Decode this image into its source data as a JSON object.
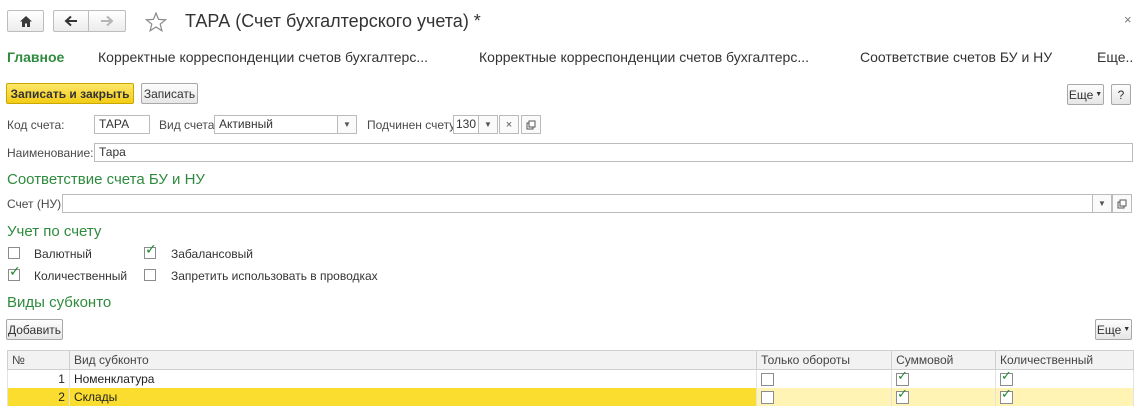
{
  "window": {
    "title": "ТАРА (Счет бухгалтерского учета) *",
    "close_glyph": "×"
  },
  "tabs": [
    {
      "label": "Главное",
      "active": true
    },
    {
      "label": "Корректные корреспонденции счетов бухгалтерс..."
    },
    {
      "label": "Корректные корреспонденции счетов бухгалтерс..."
    },
    {
      "label": "Соответствие счетов БУ и НУ"
    },
    {
      "label": "Еще..."
    }
  ],
  "toolbar": {
    "save_close_label": "Записать и закрыть",
    "save_label": "Записать",
    "more_label": "Еще",
    "help_label": "?"
  },
  "fields": {
    "code_label": "Код счета:",
    "code_value": "ТАРА",
    "type_label": "Вид счета:",
    "type_value": "Активный",
    "parent_label": "Подчинен счету:",
    "parent_value": "130",
    "name_label": "Наименование:",
    "name_value": "Тара"
  },
  "sections": {
    "mapping_title": "Соответствие счета БУ и НУ",
    "tax_account_label": "Счет (НУ):",
    "tax_account_value": "",
    "accounting_title": "Учет по счету",
    "subconto_title": "Виды субконто"
  },
  "checkboxes": [
    {
      "label": "Валютный",
      "checked": false
    },
    {
      "label": "Забалансовый",
      "checked": true
    },
    {
      "label": "Количественный",
      "checked": true
    },
    {
      "label": "Запретить использовать в проводках",
      "checked": false
    }
  ],
  "subconto": {
    "add_label": "Добавить",
    "more_label": "Еще",
    "columns": [
      "№",
      "Вид субконто",
      "Только обороты",
      "Суммовой",
      "Количественный"
    ],
    "rows": [
      {
        "num": "1",
        "name": "Номенклатура",
        "turnover_only": false,
        "sum": true,
        "quantity": true,
        "selected": false
      },
      {
        "num": "2",
        "name": "Склады",
        "turnover_only": false,
        "sum": true,
        "quantity": true,
        "selected": true
      }
    ]
  },
  "colors": {
    "accent_green": "#2e8b3e",
    "primary_yellow": "#f3cc15",
    "selected_row": "#fbdd2f"
  },
  "icons": [
    "home-icon",
    "back-arrow-icon",
    "forward-arrow-icon",
    "star-icon",
    "dropdown-arrow-icon",
    "clear-icon",
    "open-icon",
    "check-icon"
  ]
}
